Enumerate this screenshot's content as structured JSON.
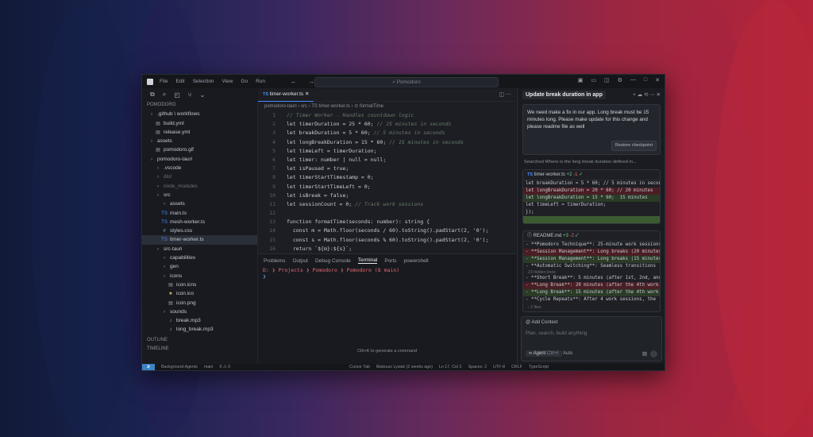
{
  "titlebar": {
    "menu": [
      "File",
      "Edit",
      "Selection",
      "View",
      "Go",
      "Run"
    ],
    "command_center": "Pomodoro"
  },
  "sidebar": {
    "title": "POMODORO",
    "items": [
      {
        "label": ".github \\ workflows",
        "type": "folder",
        "depth": 0
      },
      {
        "label": "build.yml",
        "type": "file",
        "depth": 1
      },
      {
        "label": "release.yml",
        "type": "file",
        "depth": 1
      },
      {
        "label": "assets",
        "type": "folder",
        "depth": 0
      },
      {
        "label": "pomodoro.gif",
        "type": "file",
        "depth": 1
      },
      {
        "label": "pomodoro-tauri",
        "type": "folder",
        "depth": 0
      },
      {
        "label": ".vscode",
        "type": "folder",
        "depth": 1
      },
      {
        "label": "dist",
        "type": "folder",
        "depth": 1,
        "dim": true
      },
      {
        "label": "node_modules",
        "type": "folder",
        "depth": 1,
        "dim": true
      },
      {
        "label": "src",
        "type": "folder",
        "depth": 1
      },
      {
        "label": "assets",
        "type": "folder",
        "depth": 2
      },
      {
        "label": "main.ts",
        "type": "ts",
        "depth": 2
      },
      {
        "label": "mesh-worker.ts",
        "type": "ts",
        "depth": 2
      },
      {
        "label": "styles.css",
        "type": "css",
        "depth": 2
      },
      {
        "label": "timer-worker.ts",
        "type": "ts",
        "depth": 2,
        "selected": true
      },
      {
        "label": "src-tauri",
        "type": "folder",
        "depth": 1
      },
      {
        "label": "capabilities",
        "type": "folder",
        "depth": 2
      },
      {
        "label": "gen",
        "type": "folder",
        "depth": 2
      },
      {
        "label": "icons",
        "type": "folder",
        "depth": 2
      },
      {
        "label": "icon.icns",
        "type": "file",
        "depth": 3
      },
      {
        "label": "icon.ico",
        "type": "star",
        "depth": 3
      },
      {
        "label": "icon.png",
        "type": "file",
        "depth": 3
      },
      {
        "label": "sounds",
        "type": "folder",
        "depth": 2
      },
      {
        "label": "break.mp3",
        "type": "audio",
        "depth": 3
      },
      {
        "label": "long_break.mp3",
        "type": "audio",
        "depth": 3
      }
    ],
    "outline": "OUTLINE",
    "timeline": "TIMELINE"
  },
  "editor": {
    "tab": "timer-worker.ts",
    "breadcrumb": "pomodoro-tauri  ›  src  ›  TS timer-worker.ts  ›  ⊙ formatTime",
    "lines": [
      "// Timer Worker - Handles countdown logic",
      "let timerDuration = 25 * 60; // 25 minutes in seconds",
      "let breakDuration = 5 * 60; // 5 minutes in seconds",
      "let longBreakDuration = 15 * 60; // 15 minutes in seconds",
      "let timeLeft = timerDuration;",
      "let timer: number | null = null;",
      "let isPaused = true;",
      "let timerStartTimestamp = 0;",
      "let timerStartTimeLeft = 0;",
      "let isBreak = false;",
      "let sessionCount = 0; // Track work sessions",
      "",
      "function formatTime(seconds: number): string {",
      "  const m = Math.floor(seconds / 60).toString().padStart(2, '0');",
      "  const s = Math.floor(seconds % 60).toString().padStart(2, '0');",
      "  return `${m}:${s}`;",
      "}",
      ""
    ]
  },
  "panel": {
    "tabs": [
      "Problems",
      "Output",
      "Debug Console",
      "Terminal",
      "Ports",
      "powershell"
    ],
    "active_tab": "Terminal",
    "prompt": "D: ❯ Projects ❯ Pomodoro ❯ Pomodoro (8 main)",
    "cursor": "❯",
    "hint": "Ctrl+K to generate a command"
  },
  "agent": {
    "title": "Update break duration in app",
    "message": "We need make a fix in our app. Long break must be 15 minutes long. Please make update for this change and please readme file as well",
    "restore": "Restore checkpoint",
    "searched": "Searched Where is the long break duration defined in...",
    "diff1": {
      "file": "timer-worker.ts",
      "added": "+2",
      "removed": "-1",
      "lines": [
        {
          "t": "let breakDuration = 5 * 60; // 5 minutes in second",
          "k": "n"
        },
        {
          "t": "let longBreakDuration = 20 * 60; // 20 minutes",
          "k": "r"
        },
        {
          "t": "let longBreakDuration = 15 * 60;  15 minutes",
          "k": "g"
        },
        {
          "t": "let timeLeft = timerDuration;",
          "k": "n"
        },
        {
          "t": "});",
          "k": "n"
        },
        {
          "t": "",
          "k": "ge"
        }
      ]
    },
    "diff2": {
      "file": "README.md",
      "added": "+3",
      "removed": "-2",
      "lines": [
        {
          "t": "- **Pomodoro Technique**: 25-minute work sessions",
          "k": "n"
        },
        {
          "t": "- **Session Management**: Long breaks (20 minutes)",
          "k": "r"
        },
        {
          "t": "- **Session Management**: Long breaks (15 minutes)",
          "k": "g"
        },
        {
          "t": "- **Automatic Switching**: Seamless transitions",
          "k": "n"
        },
        {
          "t": "- **Short Break**: 5 minutes (after 1st, 2nd, and",
          "k": "n"
        },
        {
          "t": "- **Long Break**: 20 minutes (after the 4th work",
          "k": "r"
        },
        {
          "t": "- **Long Break**: 15 minutes (after the 4th work",
          "k": "g"
        },
        {
          "t": "- **Cycle Repeats**: After 4 work sessions, the",
          "k": "n"
        }
      ],
      "hidden": "23 hidden lines",
      "files": "2 files"
    },
    "add_context": "Add Context",
    "placeholder": "Plan, search, build anything",
    "mode": "Agent",
    "mode_key": "Ctrl+I",
    "auto": "Auto"
  },
  "status": {
    "items": [
      "Background Agents",
      "main",
      "0 ⚠ 0",
      "Cursor Tab",
      "Mateusz Lysiak (2 weeks ago)",
      "Ln 17, Col 2",
      "Spaces: 2",
      "UTF-8",
      "CRLF",
      "TypeScript"
    ]
  }
}
